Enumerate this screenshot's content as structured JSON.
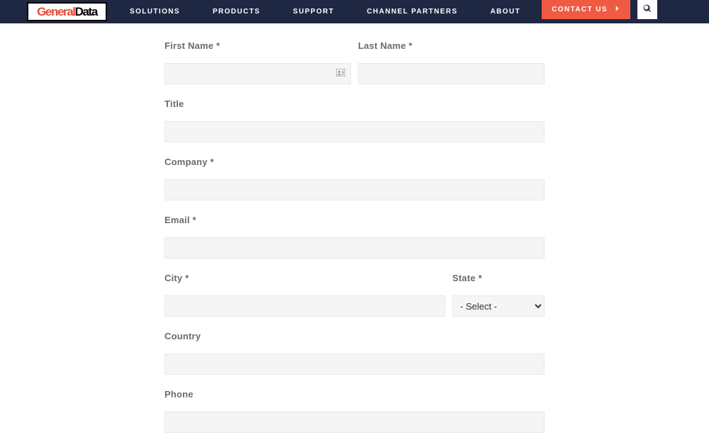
{
  "logo": {
    "part1": "General",
    "part2": "Data"
  },
  "nav": {
    "solutions": "SOLUTIONS",
    "products": "PRODUCTS",
    "support": "SUPPORT",
    "channel_partners": "CHANNEL PARTNERS",
    "about": "ABOUT"
  },
  "contact_us": "CONTACT US",
  "form": {
    "first_name_label": "First Name *",
    "last_name_label": "Last Name *",
    "title_label": "Title",
    "company_label": "Company *",
    "email_label": "Email *",
    "city_label": "City *",
    "state_label": "State *",
    "state_selected": "- Select -",
    "country_label": "Country",
    "phone_label": "Phone"
  }
}
